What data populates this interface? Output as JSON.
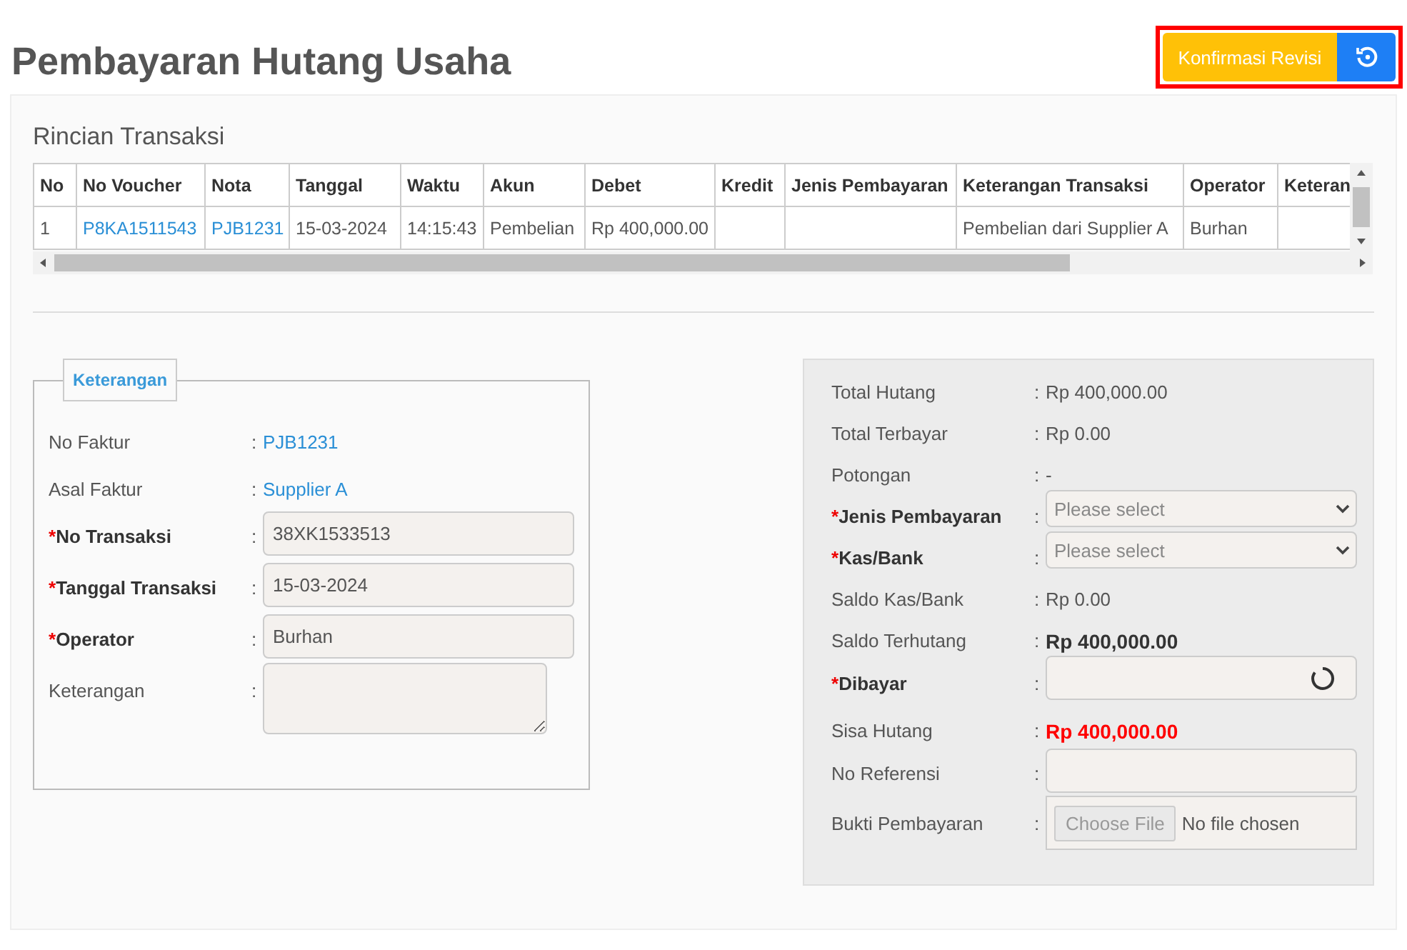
{
  "page": {
    "title": "Pembayaran Hutang Usaha"
  },
  "actions": {
    "confirm_button": "Konfirmasi Revisi"
  },
  "transactions": {
    "title": "Rincian Transaksi",
    "columns": [
      "No",
      "No Voucher",
      "Nota",
      "Tanggal",
      "Waktu",
      "Akun",
      "Debet",
      "Kredit",
      "Jenis Pembayaran",
      "Keterangan Transaksi",
      "Operator",
      "Keteran"
    ],
    "rows": [
      {
        "cells": [
          {
            "kind": "text",
            "text": "1"
          },
          {
            "kind": "link",
            "text": "P8KA1511543"
          },
          {
            "kind": "link",
            "text": "PJB1231"
          },
          {
            "kind": "text",
            "text": "15-03-2024"
          },
          {
            "kind": "text",
            "text": "14:15:43"
          },
          {
            "kind": "text",
            "text": "Pembelian"
          },
          {
            "kind": "text",
            "text": "Rp 400,000.00"
          },
          {
            "kind": "empty"
          },
          {
            "kind": "empty"
          },
          {
            "kind": "text",
            "text": "Pembelian dari Supplier A"
          },
          {
            "kind": "text",
            "text": "Burhan"
          },
          {
            "kind": "empty"
          }
        ]
      }
    ]
  },
  "details": {
    "legend": "Keterangan",
    "rows": [
      {
        "kind": "link",
        "label": "No Faktur",
        "colon": ":",
        "value": "PJB1231"
      },
      {
        "kind": "link",
        "label": "Asal Faktur",
        "colon": ":",
        "value": "Supplier A"
      },
      {
        "kind": "input",
        "marker": "*",
        "label": "No Transaksi",
        "colon": ":",
        "value": "38XK1533513"
      },
      {
        "kind": "input",
        "marker": "*",
        "label": "Tanggal Transaksi",
        "colon": ":",
        "value": "15-03-2024"
      },
      {
        "kind": "input",
        "marker": "*",
        "label": "Operator",
        "colon": ":",
        "value": "Burhan"
      },
      {
        "kind": "textarea",
        "label": "Keterangan",
        "colon": ":"
      }
    ]
  },
  "payment": {
    "rows": [
      {
        "kind": "text",
        "label": "Total Hutang",
        "colon": ":",
        "value": "Rp 400,000.00"
      },
      {
        "kind": "text",
        "label": "Total Terbayar",
        "colon": ":",
        "value": "Rp 0.00"
      },
      {
        "kind": "text",
        "label": "Potongan",
        "colon": ":",
        "value": "-"
      },
      {
        "kind": "select",
        "marker": "*",
        "label": "Jenis Pembayaran",
        "colon": ":",
        "placeholder": "Please select"
      },
      {
        "kind": "select",
        "marker": "*",
        "label": "Kas/Bank",
        "colon": ":",
        "placeholder": "Please select"
      },
      {
        "kind": "text",
        "label": "Saldo Kas/Bank",
        "colon": ":",
        "value": "Rp 0.00"
      },
      {
        "kind": "bold",
        "label": "Saldo Terhutang",
        "colon": ":",
        "value": "Rp 400,000.00"
      },
      {
        "kind": "loading-input",
        "marker": "*",
        "label": "Dibayar",
        "colon": ":"
      },
      {
        "kind": "danger",
        "label": "Sisa Hutang",
        "colon": ":",
        "value": "Rp 400,000.00"
      },
      {
        "kind": "input",
        "label": "No Referensi",
        "colon": ":"
      },
      {
        "kind": "file",
        "label": "Bukti Pembayaran",
        "colon": ":",
        "button": "Choose File",
        "status": "No file chosen"
      }
    ]
  }
}
